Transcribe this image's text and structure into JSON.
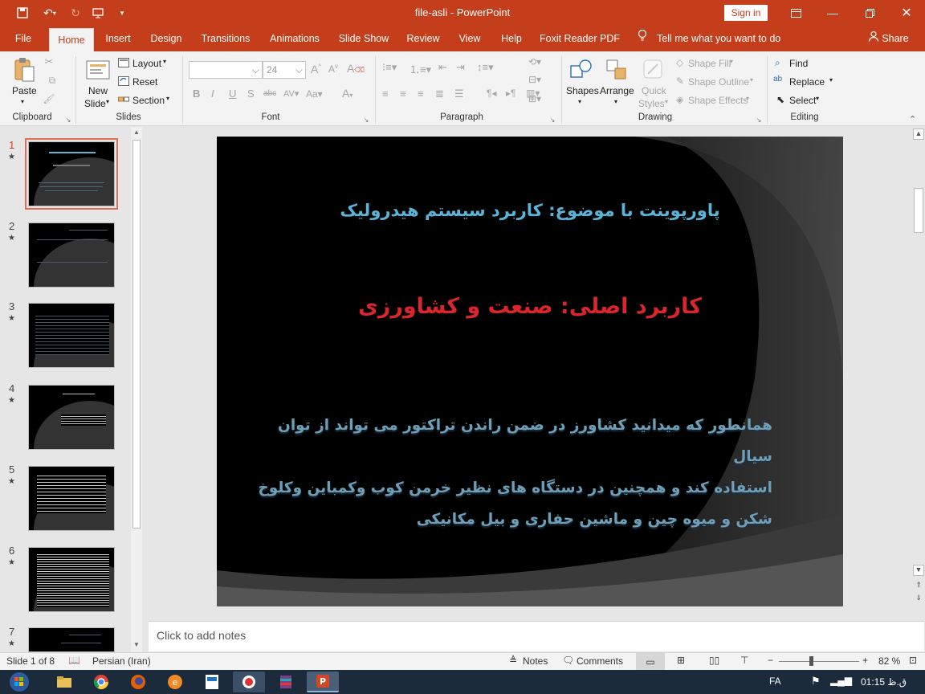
{
  "window": {
    "title": "file-asli  -  PowerPoint",
    "signin": "Sign in"
  },
  "tabs": [
    "File",
    "Home",
    "Insert",
    "Design",
    "Transitions",
    "Animations",
    "Slide Show",
    "Review",
    "View",
    "Help",
    "Foxit Reader PDF"
  ],
  "tell_me": "Tell me what you want to do",
  "share": "Share",
  "ribbon": {
    "clipboard": {
      "label": "Clipboard",
      "paste": "Paste"
    },
    "slides": {
      "label": "Slides",
      "new_slide_1": "New",
      "new_slide_2": "Slide",
      "layout": "Layout",
      "reset": "Reset",
      "section": "Section"
    },
    "font": {
      "label": "Font",
      "size": "24"
    },
    "paragraph": {
      "label": "Paragraph"
    },
    "drawing": {
      "label": "Drawing",
      "shapes": "Shapes",
      "arrange": "Arrange",
      "quick_styles_1": "Quick",
      "quick_styles_2": "Styles",
      "shape_fill": "Shape Fill",
      "shape_outline": "Shape Outline",
      "shape_effects": "Shape Effects"
    },
    "editing": {
      "label": "Editing",
      "find": "Find",
      "replace": "Replace",
      "select": "Select"
    }
  },
  "thumbnails": [
    "1",
    "2",
    "3",
    "4",
    "5",
    "6",
    "7"
  ],
  "slide": {
    "title": "پاورپوینت با موضوع: کاربرد سیستم هیدرولیک",
    "subtitle": "کاربرد اصلی: صنعت و کشاورزی",
    "body_line1": "همانطور که میدانید  کشاورز در ضمن راندن تراکتور می تواند از توان سیال",
    "body_line2": "استفاده کند و همچنین در دستگاه های نظیر خرمن کوب وکمباین وکلوخ",
    "body_line3": "شکن و میوه چین و ماشین حفاری و بیل مکانیکی",
    "title_color": "#5bb4d8",
    "subtitle_color": "#d9262c"
  },
  "notes_placeholder": "Click to add notes",
  "status": {
    "slide_of": "Slide 1 of 8",
    "language": "Persian (Iran)",
    "notes": "Notes",
    "comments": "Comments",
    "zoom": "82 %"
  },
  "taskbar": {
    "lang": "FA",
    "time": "01:15 ق.ظ"
  }
}
